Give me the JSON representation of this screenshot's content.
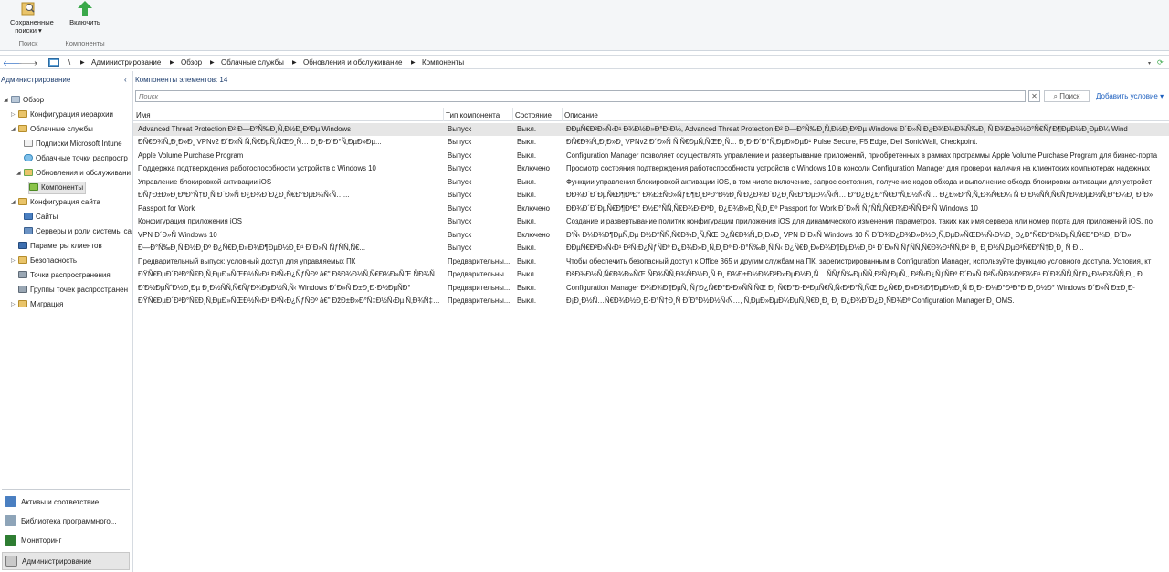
{
  "ribbon": {
    "saved_searches_label": "Сохраненные поиски ▾",
    "enable_label": "Включить",
    "group_search": "Поиск",
    "group_components": "Компоненты"
  },
  "address": {
    "path": [
      "\\",
      "Администрирование",
      "Обзор",
      "Облачные службы",
      "Обновления и обслуживание",
      "Компоненты"
    ]
  },
  "nav": {
    "header": "Администрирование",
    "collapse_glyph": "‹",
    "tree": [
      {
        "label": "Обзор"
      },
      {
        "label": "Конфигурация иерархии"
      },
      {
        "label": "Облачные службы"
      },
      {
        "label": "Подписки Microsoft Intune"
      },
      {
        "label": "Облачные точки распростр"
      },
      {
        "label": "Обновления и обслуживани"
      },
      {
        "label": "Компоненты"
      },
      {
        "label": "Конфигурация сайта"
      },
      {
        "label": "Сайты"
      },
      {
        "label": "Серверы и роли системы са"
      },
      {
        "label": "Параметры клиентов"
      },
      {
        "label": "Безопасность"
      },
      {
        "label": "Точки распространения"
      },
      {
        "label": "Группы точек распространен"
      },
      {
        "label": "Миграция"
      }
    ],
    "workspaces": [
      {
        "label": "Активы и соответствие"
      },
      {
        "label": "Библиотека программного..."
      },
      {
        "label": "Мониторинг"
      },
      {
        "label": "Администрирование"
      }
    ]
  },
  "list": {
    "count_label": "Компоненты элементов: 14",
    "search_placeholder": "Поиск",
    "search_button": "Поиск",
    "clear_glyph": "✕",
    "add_criteria": "Добавить условие ▾",
    "columns": [
      "Имя",
      "Тип компонента",
      "Состояние",
      "Описание"
    ],
    "rows": [
      {
        "name": "Advanced Threat Protection Ð² Ð—Ð°Ñ‰Ð¸Ñ‚Ð½Ð¸ÐºÐµ Windows",
        "type": "Выпуск",
        "state": "Выкл.",
        "desc": "ÐÐµÑ€Ð²Ð»Ñ‹Ð¹ Ð¾Ð½Ð»Ð°Ð¹Ð½, Advanced Threat Protection Ð² Ð—Ð°Ñ‰Ð¸Ñ‚Ð½Ð¸ÐºÐµ Windows Ð´Ð»Ñ Ð¿Ð¾Ð¼Ð¾Ñ‰Ð¸ Ñ Ð¾Ð±Ð½Ð°Ñ€ÑƒÐ¶ÐµÐ½Ð¸ÐµÐ¼ Wind"
      },
      {
        "name": "ÐÑ€Ð¾Ñ„Ð¸Ð»Ð¸ VPNv2 Ð´Ð»Ñ Ñ‚Ñ€ÐµÑ‚ÑŒÐ¸Ñ… Ð¸Ð·Ð´Ð°Ñ‚ÐµÐ»Ðµ...",
        "type": "Выпуск",
        "state": "Выкл.",
        "desc": "ÐÑ€Ð¾Ñ„Ð¸Ð»Ð¸ VPNv2 Ð´Ð»Ñ Ñ‚Ñ€ÐµÑ‚ÑŒÐ¸Ñ… Ð¸Ð·Ð´Ð°Ñ‚ÐµÐ»ÐµÐ¹ Pulse Secure, F5 Edge, Dell SonicWall, Checkpoint."
      },
      {
        "name": "Apple Volume Purchase Program",
        "type": "Выпуск",
        "state": "Выкл.",
        "desc": "Configuration Manager позволяет осуществлять управление и развертывание приложений, приобретенных в рамках программы Apple Volume Purchase Program для бизнес-порта"
      },
      {
        "name": "Поддержка подтверждения работоспособности устройств с Windows 10",
        "type": "Выпуск",
        "state": "Включено",
        "desc": "Просмотр состояния подтверждения работоспособности устройств с Windows 10 в консоли Configuration Manager для проверки наличия на клиентских компьютерах надежных"
      },
      {
        "name": "Управление блокировкой активации iOS",
        "type": "Выпуск",
        "state": "Выкл.",
        "desc": "Функции управления блокировкой активации iOS, в том числе включение, запрос состояния, получение кодов обхода и выполнение обхода блокировки активации для устройст"
      },
      {
        "name": "ÐÑƒÐ±Ð»Ð¸ÐºÐ°Ñ†Ð¸Ñ Ð´Ð»Ñ Ð¿Ð¾Ð´Ð¿Ð¸Ñ€Ð°ÐµÐ¼Ñ‹Ñ…...",
        "type": "Выпуск",
        "state": "Выкл.",
        "desc": "ÐÐ¾Ð´Ð´ÐµÑ€Ð¶ÐºÐ° Ð¾Ð±ÑÐ»ÑƒÐ¶Ð¸Ð²Ð°Ð½Ð¸Ñ Ð¿Ð¾Ð´Ð¿Ð¸Ñ€Ð°ÐµÐ¼Ñ‹Ñ… Ð°Ð¿Ð¿Ð°Ñ€Ð°Ñ‚Ð½Ñ‹Ñ… Ð¿Ð»Ð°Ñ‚Ñ„Ð¾Ñ€Ð¼ Ñ Ð¸Ð½ÑÑ‚Ñ€ÑƒÐ¼ÐµÐ½Ñ‚Ð°Ð¼Ð¸ Ð´Ð»"
      },
      {
        "name": "Passport for Work",
        "type": "Выпуск",
        "state": "Включено",
        "desc": "ÐÐ¾Ð´Ð´ÐµÑ€Ð¶ÐºÐ° Ð½Ð°ÑÑ‚Ñ€Ð¾Ð¹ÐºÐ¸ Ð¿Ð¾Ð»Ð¸Ñ‚Ð¸Ðº Passport for Work Ð´Ð»Ñ ÑƒÑÑ‚Ñ€Ð¾Ð¹ÑÑ‚Ð² Ñ Windows 10"
      },
      {
        "name": "Конфигурация приложения iOS",
        "type": "Выпуск",
        "state": "Выкл.",
        "desc": "Создание и развертывание политик конфигурации приложения iOS для динамического изменения параметров, таких как имя сервера или номер порта для приложений iOS, по"
      },
      {
        "name": "VPN Ð´Ð»Ñ Windows 10",
        "type": "Выпуск",
        "state": "Включено",
        "desc": "Ð'Ñ‹ Ð¼Ð¾Ð¶ÐµÑ‚Ðµ Ð½Ð°ÑÑ‚Ñ€Ð¾Ð¸Ñ‚ÑŒ Ð¿Ñ€Ð¾Ñ„Ð¸Ð»Ð¸ VPN Ð´Ð»Ñ Windows 10 Ñ Ð´Ð¾Ð¿Ð¾Ð»Ð½Ð¸Ñ‚ÐµÐ»ÑŒÐ½Ñ‹Ð¼Ð¸ Ð¿Ð°Ñ€Ð°Ð¼ÐµÑ‚Ñ€Ð°Ð¼Ð¸ Ð´Ð»"
      },
      {
        "name": "Ð—Ð°Ñ‰Ð¸Ñ‚Ð½Ð¸Ðº Ð¿Ñ€Ð¸Ð»Ð¾Ð¶ÐµÐ½Ð¸Ð¹ Ð´Ð»Ñ ÑƒÑÑ‚Ñ€...",
        "type": "Выпуск",
        "state": "Выкл.",
        "desc": "ÐÐµÑ€Ð²Ð»Ñ‹Ð¹ Ð²Ñ‹Ð¿ÑƒÑÐº Ð¿Ð¾Ð»Ð¸Ñ‚Ð¸Ðº Ð·Ð°Ñ‰Ð¸Ñ‚Ñ‹ Ð¿Ñ€Ð¸Ð»Ð¾Ð¶ÐµÐ½Ð¸Ð¹ Ð´Ð»Ñ ÑƒÑÑ‚Ñ€Ð¾Ð¹ÑÑ‚Ð² Ð¸ Ð¸Ð½Ñ‚ÐµÐ³Ñ€Ð°Ñ†Ð¸Ð¸ Ñ Ð..."
      },
      {
        "name": "Предварительный выпуск: условный доступ для управляемых ПК",
        "type": "Предварительны...",
        "state": "Выкл.",
        "desc": "Чтобы обеспечить безопасный доступ к Office 365 и другим службам на ПК, зарегистрированным в Configuration Manager, используйте функцию условного доступа. Условия, кт"
      },
      {
        "name": "ÐŸÑ€ÐµÐ´Ð²Ð°Ñ€Ð¸Ñ‚ÐµÐ»ÑŒÐ½Ñ‹Ð¹ Ð²Ñ‹Ð¿ÑƒÑÐº â€\" ÐšÐ¾Ð½Ñ‚Ñ€Ð¾Ð»ÑŒ ÑÐ¾ÑÑ‚Ð¾ÑÐ½...",
        "type": "Предварительны...",
        "state": "Выкл.",
        "desc": "ÐšÐ¾Ð½Ñ‚Ñ€Ð¾Ð»ÑŒ ÑÐ¾ÑÑ‚Ð¾ÑÐ½Ð¸Ñ Ð¸ Ð¾Ð±Ð½Ð¾Ð²Ð»ÐµÐ½Ð¸Ñ... ÑÑƒÑ‰ÐµÑÑ‚Ð²ÑƒÐµÑ‚, Ð²Ñ‹Ð¿ÑƒÑÐº Ð´Ð»Ñ Ð²Ñ‹ÑÐ¾ÐºÐ¾Ð¹ Ð´Ð¾ÑÑ‚ÑƒÐ¿Ð½Ð¾ÑÑ‚Ð¸, Ð..."
      },
      {
        "name": "Ð'Ð½ÐµÑˆÐ½Ð¸Ðµ Ð¸Ð½ÑÑ‚Ñ€ÑƒÐ¼ÐµÐ½Ñ‚Ñ‹ Windows Ð´Ð»Ñ Ð±Ð¸Ð·Ð½ÐµÑÐ°",
        "type": "Предварительны...",
        "state": "Выкл.",
        "desc": "Configuration Manager Ð¼Ð¾Ð¶ÐµÑ‚ ÑƒÐ¿Ñ€Ð°Ð²Ð»ÑÑ‚ÑŒ Ð¸ Ñ€Ð°Ð·Ð²ÐµÑ€Ñ‚Ñ‹Ð²Ð°Ñ‚ÑŒ Ð¿Ñ€Ð¸Ð»Ð¾Ð¶ÐµÐ½Ð¸Ñ Ð¸Ð· Ð¼Ð°Ð³Ð°Ð·Ð¸Ð½Ð° Windows Ð´Ð»Ñ Ð±Ð¸Ð·"
      },
      {
        "name": "ÐŸÑ€ÐµÐ´Ð²Ð°Ñ€Ð¸Ñ‚ÐµÐ»ÑŒÐ½Ñ‹Ð¹ Ð²Ñ‹Ð¿ÑƒÑÐº â€\" ÐžÐ±Ð»Ð°Ñ‡Ð½Ñ‹Ðµ Ñ‚Ð¾Ñ‡Ðº...",
        "type": "Предварительны...",
        "state": "Выкл.",
        "desc": "Ð¡Ð¸Ð½Ñ…Ñ€Ð¾Ð½Ð¸Ð·Ð°Ñ†Ð¸Ñ Ð´Ð°Ð½Ð½Ñ‹Ñ…, Ñ‚ÐµÐ»ÐµÐ¼ÐµÑ‚Ñ€Ð¸Ð¸ Ð¸ Ð¿Ð¾Ð´Ð¿Ð¸ÑÐ¾Ðº Configuration Manager Ð¸ OMS."
      }
    ]
  },
  "colors": {
    "folder": "#e9c46a",
    "selected_row": "#e6e6e6",
    "link": "#1c5fbf",
    "ribbon_bg": "#f4f6f8"
  }
}
